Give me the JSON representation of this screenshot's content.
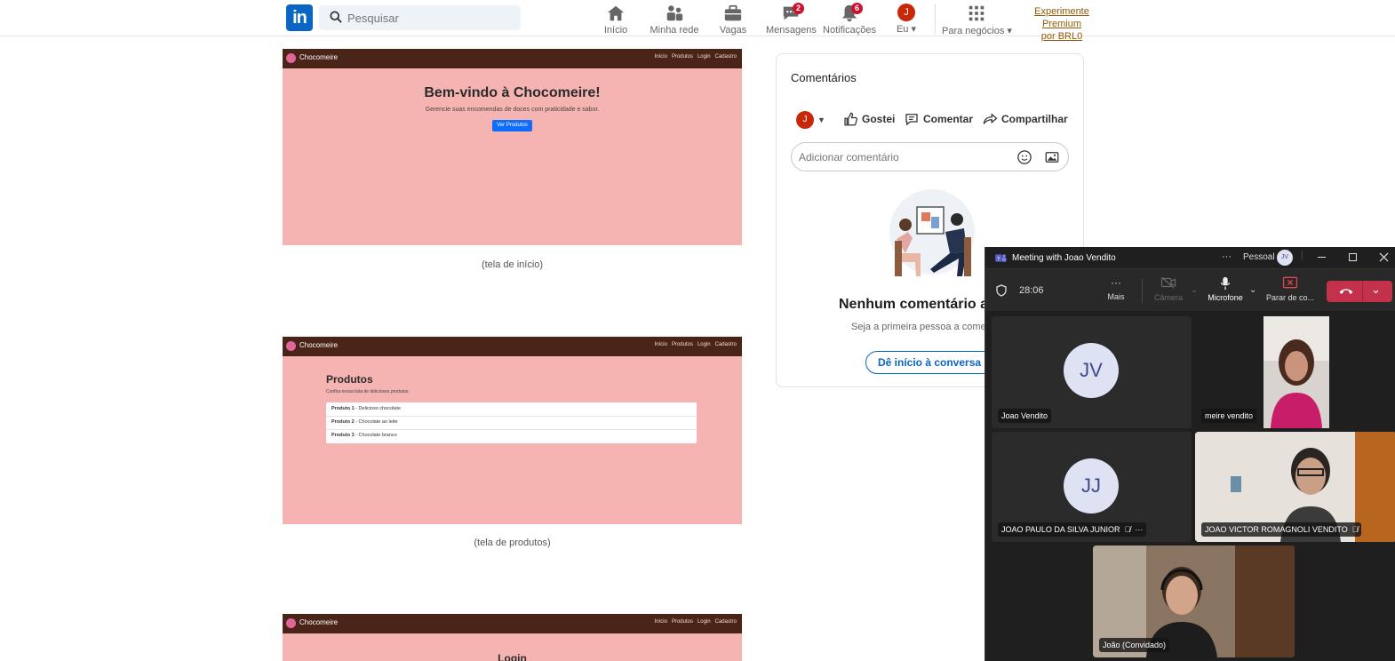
{
  "linkedin": {
    "logo": "in",
    "search_placeholder": "Pesquisar",
    "nav": [
      {
        "label": "Início",
        "icon": "home-icon"
      },
      {
        "label": "Minha rede",
        "icon": "network-icon"
      },
      {
        "label": "Vagas",
        "icon": "briefcase-icon"
      },
      {
        "label": "Mensagens",
        "icon": "messages-icon",
        "badge": "2"
      },
      {
        "label": "Notificações",
        "icon": "bell-icon",
        "badge": "6"
      },
      {
        "label": "Eu ▾",
        "avatar": "J"
      },
      {
        "label": "Para negócios ▾",
        "icon": "grid-icon"
      }
    ],
    "premium_line1": "Experimente Premium",
    "premium_line2": "por BRL0"
  },
  "post": {
    "brand": "Chocomeire",
    "nav_links": [
      "Início",
      "Produtos",
      "Login",
      "Cadastro"
    ],
    "shot1": {
      "heading": "Bem-vindo à Chocomeire!",
      "subtitle": "Gerencie suas encomendas de doces com praticidade e sabor.",
      "button": "Ver Produtos",
      "caption": "(tela de início)"
    },
    "shot2": {
      "heading": "Produtos",
      "subtitle": "Confira nossa lista de deliciosos produtos:",
      "items": [
        {
          "name": "Produto 1",
          "desc": " - Delicioso chocolate"
        },
        {
          "name": "Produto 2",
          "desc": " - Chocolate ao leite"
        },
        {
          "name": "Produto 3",
          "desc": " - Chocolate branco"
        }
      ],
      "caption": "(tela de produtos)"
    },
    "shot3": {
      "heading": "Login"
    }
  },
  "comments": {
    "title": "Comentários",
    "avatar": "J",
    "actions": [
      "Gostei",
      "Comentar",
      "Compartilhar"
    ],
    "input_placeholder": "Adicionar comentário",
    "empty_title": "Nenhum comentário ainda",
    "empty_sub": "Seja a primeira pessoa a comentar",
    "start_button": "Dê início à conversa"
  },
  "teams": {
    "title": "Meeting with Joao Vendito",
    "more": "···",
    "account_label": "Pessoal",
    "account_initials": "JV",
    "timer": "28:06",
    "toolbar": {
      "more": "Mais",
      "camera": "Câmera",
      "mic": "Microfone",
      "stop": "Parar de co..."
    },
    "participants": [
      {
        "name": "Joao Vendito",
        "initials": "JV"
      },
      {
        "name": "meire vendito"
      },
      {
        "name": "JOAO PAULO DA SILVA JUNIOR",
        "initials": "JJ"
      },
      {
        "name": "JOAO VICTOR ROMAGNOLI VENDITO"
      },
      {
        "name": "João (Convidado)"
      }
    ]
  },
  "colors": {
    "linkedin_blue": "#0a66c2",
    "badge_red": "#cb112d",
    "site_bar": "#4a2416",
    "site_bg": "#f5b4b1",
    "teams_bg": "#1f1f1f",
    "end_call": "#c4314b"
  }
}
